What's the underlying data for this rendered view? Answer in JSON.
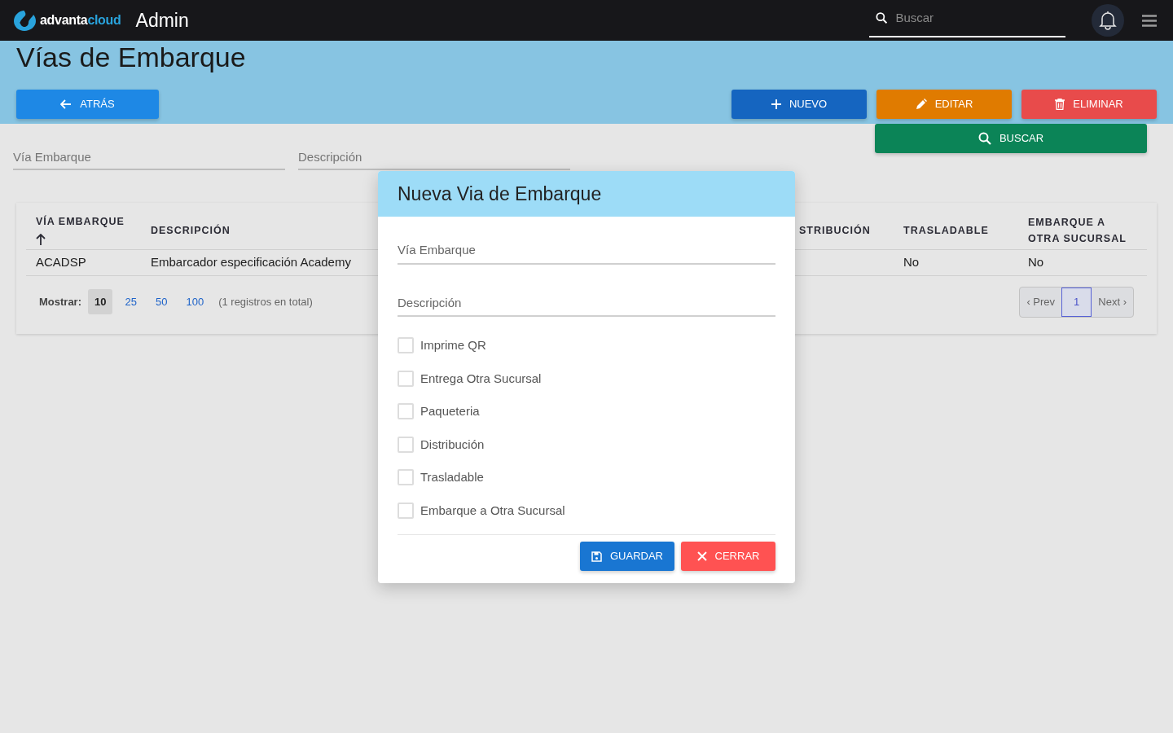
{
  "navbar": {
    "logo": {
      "text_1": "advanta",
      "text_2": "cloud"
    },
    "app_title": "Admin",
    "search": {
      "placeholder": "Buscar"
    }
  },
  "page": {
    "title": "Vías de Embarque",
    "buttons": [
      {
        "kind": "back",
        "label": "ATRÁS"
      },
      {
        "kind": "new",
        "label": "NUEVO"
      },
      {
        "kind": "edit",
        "label": "EDITAR"
      },
      {
        "kind": "delete",
        "label": "ELIMINAR"
      }
    ],
    "search_button": {
      "label": "BUSCAR"
    }
  },
  "filters": [
    {
      "placeholder": "Vía Embarque"
    },
    {
      "placeholder": "Descripción"
    }
  ],
  "table": {
    "columns": [
      {
        "label": "VÍA EMBARQUE",
        "sorted": true
      },
      {
        "label": "DESCRIPCIÓN",
        "sorted": false
      },
      {
        "label": "STRIBUCIÓN",
        "sorted": false
      },
      {
        "label": "TRASLADABLE",
        "sorted": false
      },
      {
        "label": "EMBARQUE A OTRA SUCURSAL",
        "sorted": false
      }
    ],
    "rows": [
      {
        "cells": [
          "ACADSP",
          "Embarcador especificación Academy",
          null,
          "No",
          "No"
        ]
      }
    ],
    "footer": {
      "show_label": "Mostrar:",
      "page_sizes": [
        {
          "label": "10",
          "selected": true
        },
        {
          "label": "25",
          "selected": false
        },
        {
          "label": "50",
          "selected": false
        },
        {
          "label": "100",
          "selected": false
        }
      ],
      "total": "(1 registros en total)",
      "prev": "‹ Prev",
      "pages": [
        {
          "label": "1",
          "selected": true
        }
      ],
      "next": "Next ›"
    }
  },
  "modal": {
    "title": "Nueva Via de Embarque",
    "fields": [
      {
        "placeholder": "Vía Embarque"
      },
      {
        "placeholder": "Descripción"
      }
    ],
    "checkboxes": [
      {
        "label": "Imprime QR",
        "checked": false
      },
      {
        "label": "Entrega Otra Sucursal",
        "checked": false
      },
      {
        "label": "Paqueteria",
        "checked": false
      },
      {
        "label": "Distribución",
        "checked": false
      },
      {
        "label": "Trasladable",
        "checked": false
      },
      {
        "label": "Embarque a Otra Sucursal",
        "checked": false
      }
    ],
    "buttons": [
      {
        "kind": "save",
        "label": "GUARDAR"
      },
      {
        "kind": "close",
        "label": "CERRAR"
      }
    ]
  }
}
